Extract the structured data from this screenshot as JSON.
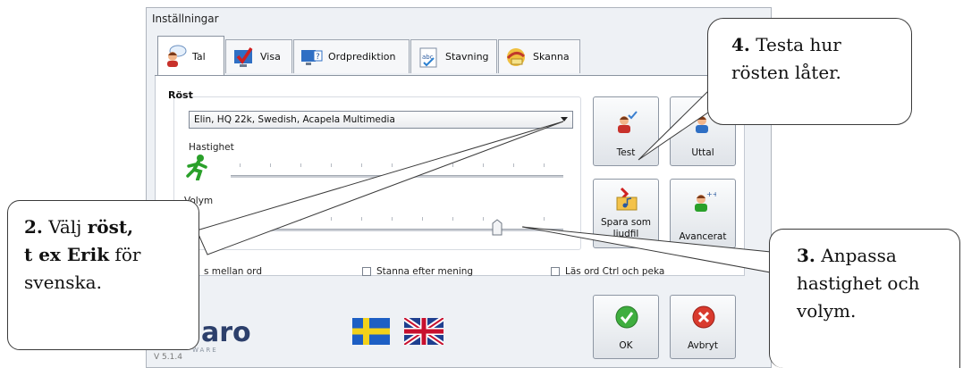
{
  "window": {
    "title": "Inställningar"
  },
  "tabs": [
    {
      "label": "Tal",
      "icon": "speaker-person-icon",
      "active": true
    },
    {
      "label": "Visa",
      "icon": "checkmark-monitor-icon",
      "active": false
    },
    {
      "label": "Ordprediktion",
      "icon": "monitor-question-icon",
      "active": false
    },
    {
      "label": "Stavning",
      "icon": "abc-check-icon",
      "active": false
    },
    {
      "label": "Skanna",
      "icon": "scan-arrow-icon",
      "active": false
    }
  ],
  "voice": {
    "group_label": "Röst",
    "selected": "Elin, HQ 22k, Swedish, Acapela Multimedia",
    "speed_label": "Hastighet",
    "volume_label": "Volym",
    "volume_level": 0.8
  },
  "buttons": {
    "test": "Test",
    "uttal": "Uttal",
    "save": "Spara som",
    "save_line2": "ljudfil",
    "advanced": "Avancerat",
    "ok": "OK",
    "cancel": "Avbryt"
  },
  "options": {
    "pause_partial": "s mellan ord",
    "stop_after_sentence": "Stanna efter mening",
    "read_ctrl": "Läs ord Ctrl och peka"
  },
  "brand": {
    "logo_fragment": "aro",
    "sub_fragment": "WARE",
    "version": "V 5.1.4"
  },
  "flags": [
    "sweden-flag-icon",
    "uk-flag-icon"
  ],
  "callouts": {
    "c2": {
      "num": "2.",
      "t1": " Välj ",
      "b1": "röst,",
      "b2": "t ex Erik",
      "t2": " för",
      "t3": "svenska."
    },
    "c3": {
      "num": "3.",
      "t1": " Anpassa",
      "t2": "hastighet och",
      "t3": "volym."
    },
    "c4": {
      "num": "4.",
      "t1": " Testa hur",
      "t2": "rösten låter."
    }
  }
}
